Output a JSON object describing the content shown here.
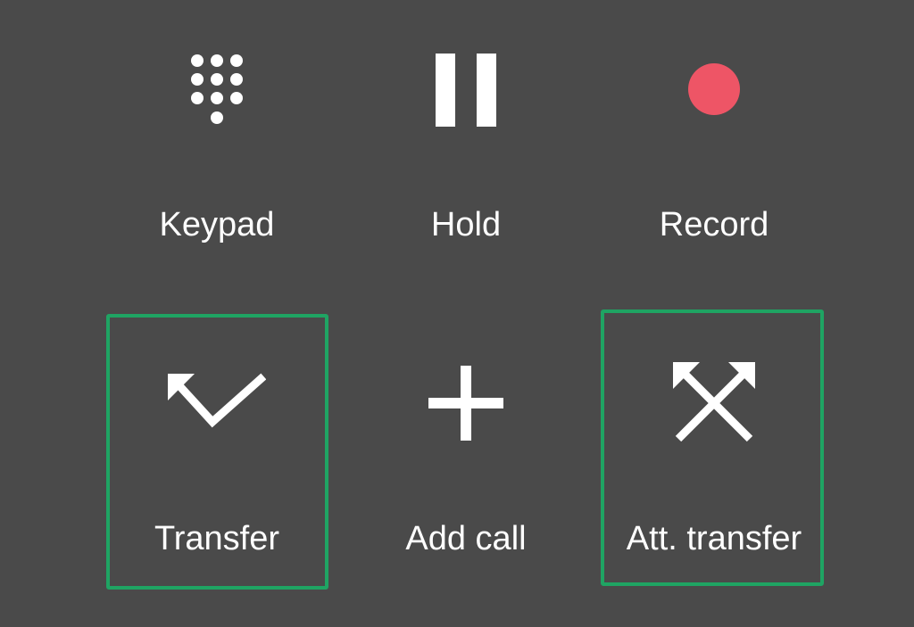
{
  "controls": [
    {
      "label": "Keypad",
      "icon": "dialpad-icon"
    },
    {
      "label": "Hold",
      "icon": "pause-icon"
    },
    {
      "label": "Record",
      "icon": "record-icon"
    },
    {
      "label": "Transfer",
      "icon": "transfer-icon"
    },
    {
      "label": "Add call",
      "icon": "add-icon"
    },
    {
      "label": "Att. transfer",
      "icon": "attended-transfer-icon"
    }
  ],
  "highlighted": [
    "Transfer",
    "Att. transfer"
  ],
  "colors": {
    "background": "#4a4a4a",
    "foreground": "#ffffff",
    "record": "#ee5566",
    "highlight": "#1fa463"
  }
}
